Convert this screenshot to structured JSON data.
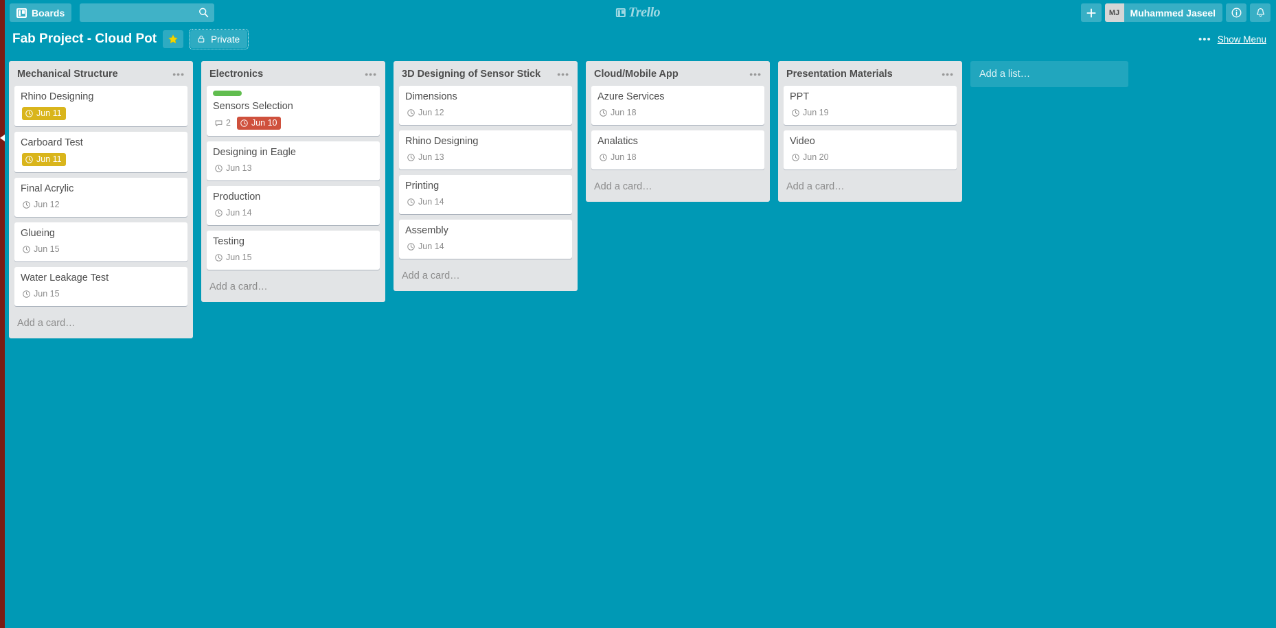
{
  "header": {
    "boards_label": "Boards",
    "search_placeholder": "",
    "search_value": "",
    "logo_text": "Trello",
    "add_label": "+",
    "user_initials": "MJ",
    "user_name": "Muhammed Jaseel"
  },
  "board_bar": {
    "title": "Fab Project - Cloud Pot",
    "visibility": "Private",
    "show_menu": "Show Menu",
    "dots": "•••"
  },
  "board": {
    "add_list_placeholder": "Add a list…",
    "add_card_placeholder": "Add a card…",
    "lists": [
      {
        "title": "Mechanical Structure",
        "cards": [
          {
            "title": "Rhino Designing",
            "due": "Jun 11",
            "due_state": "due-soon"
          },
          {
            "title": "Carboard Test",
            "due": "Jun 11",
            "due_state": "due-soon"
          },
          {
            "title": "Final Acrylic",
            "due": "Jun 12",
            "due_state": "plain"
          },
          {
            "title": "Glueing",
            "due": "Jun 15",
            "due_state": "plain"
          },
          {
            "title": "Water Leakage Test",
            "due": "Jun 15",
            "due_state": "plain"
          }
        ]
      },
      {
        "title": "Electronics",
        "cards": [
          {
            "title": "Sensors Selection",
            "due": "Jun 10",
            "due_state": "overdue",
            "label_color": "#61bd4f",
            "comments": "2"
          },
          {
            "title": "Designing in Eagle",
            "due": "Jun 13",
            "due_state": "plain"
          },
          {
            "title": "Production",
            "due": "Jun 14",
            "due_state": "plain"
          },
          {
            "title": "Testing",
            "due": "Jun 15",
            "due_state": "plain"
          }
        ]
      },
      {
        "title": "3D Designing of Sensor Stick",
        "cards": [
          {
            "title": "Dimensions",
            "due": "Jun 12",
            "due_state": "plain"
          },
          {
            "title": "Rhino Designing",
            "due": "Jun 13",
            "due_state": "plain"
          },
          {
            "title": "Printing",
            "due": "Jun 14",
            "due_state": "plain"
          },
          {
            "title": "Assembly",
            "due": "Jun 14",
            "due_state": "plain"
          }
        ]
      },
      {
        "title": "Cloud/Mobile App",
        "cards": [
          {
            "title": "Azure Services",
            "due": "Jun 18",
            "due_state": "plain"
          },
          {
            "title": "Analatics",
            "due": "Jun 18",
            "due_state": "plain"
          }
        ]
      },
      {
        "title": "Presentation Materials",
        "cards": [
          {
            "title": "PPT",
            "due": "Jun 19",
            "due_state": "plain"
          },
          {
            "title": "Video",
            "due": "Jun 20",
            "due_state": "plain"
          }
        ]
      }
    ]
  },
  "colors": {
    "board_background": "#0099b5",
    "header_background": "#0099b5",
    "list_background": "#e2e4e6",
    "card_background": "#ffffff",
    "due_soon": "#d9b51c",
    "overdue": "#cf513d",
    "green_label": "#61bd4f",
    "star": "#f2d600",
    "edge_strip": "#7a1c15"
  }
}
